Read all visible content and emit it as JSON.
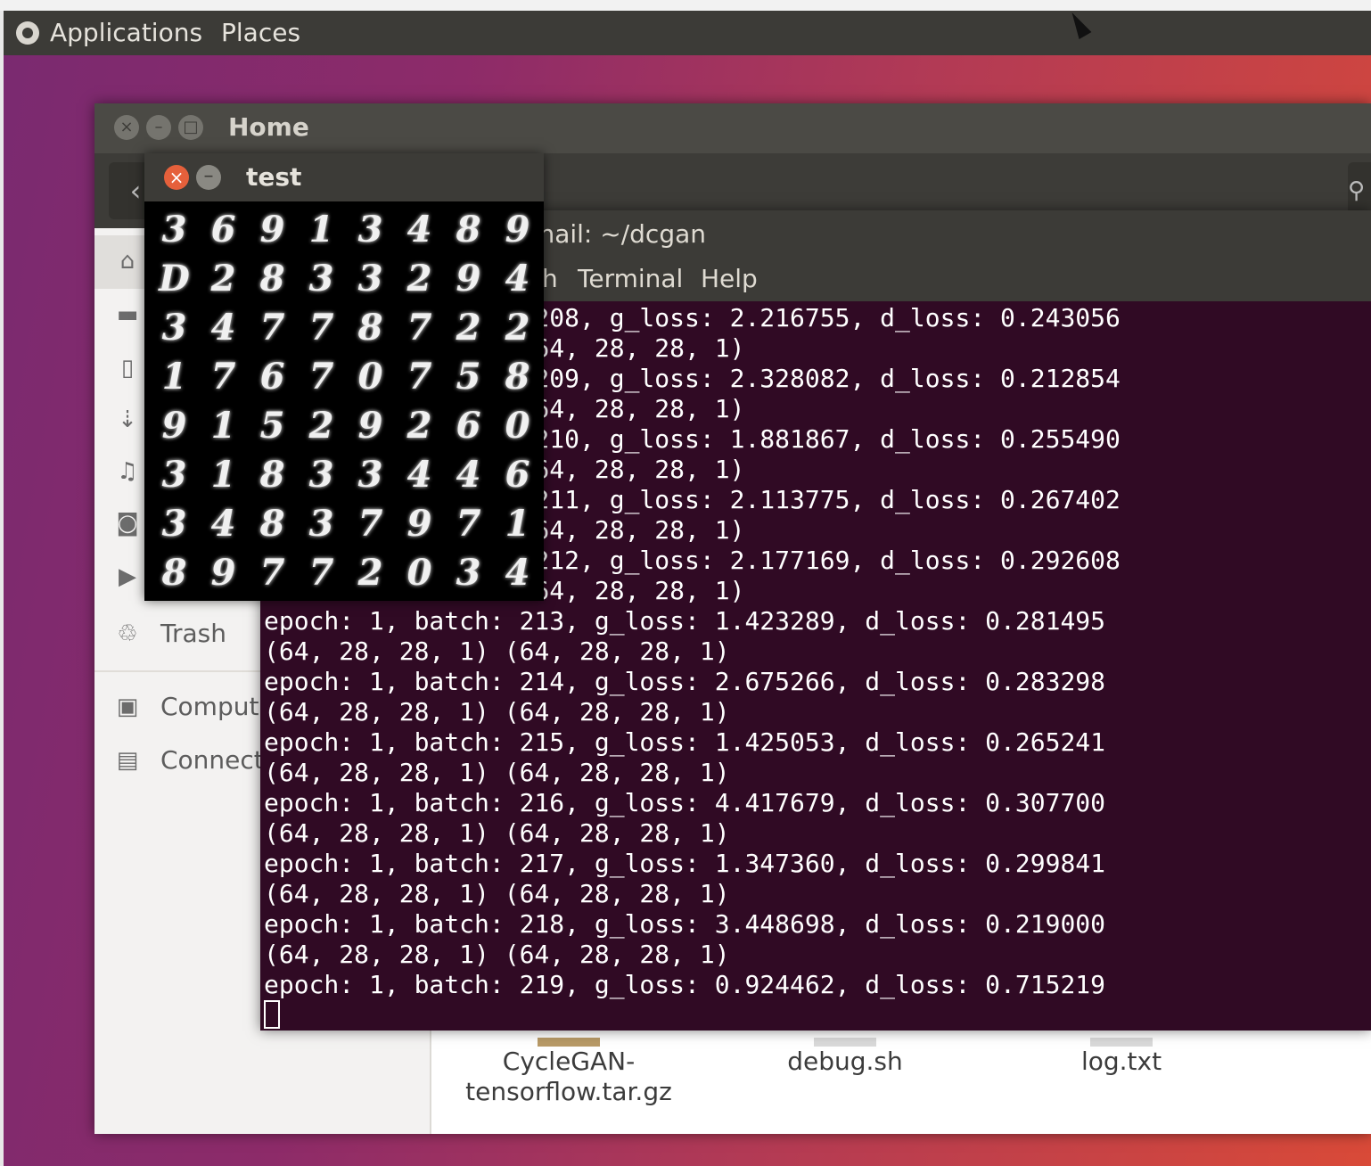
{
  "panel": {
    "menus": [
      "Applications",
      "Places"
    ]
  },
  "home_window": {
    "title": "Home",
    "sidebar": [
      {
        "icon": "home-icon",
        "label": ""
      },
      {
        "icon": "folder-icon",
        "label": ""
      },
      {
        "icon": "document-icon",
        "label": ""
      },
      {
        "icon": "download-icon",
        "label": ""
      },
      {
        "icon": "music-icon",
        "label": ""
      },
      {
        "icon": "camera-icon",
        "label": ""
      },
      {
        "icon": "video-icon",
        "label": ""
      },
      {
        "icon": "trash-icon",
        "label": "Trash"
      },
      {
        "icon": "computer-icon",
        "label": "Comput"
      },
      {
        "icon": "connect-icon",
        "label": "Connect"
      }
    ],
    "files": [
      {
        "name": "CycleGAN-\ntensorflow.tar.gz",
        "icon": "archive-icon"
      },
      {
        "name": "debug.sh",
        "icon": "script-icon"
      },
      {
        "name": "log.txt",
        "icon": "text-file-icon"
      }
    ]
  },
  "terminal": {
    "title": "nail: ~/dcgan",
    "menu": [
      "h",
      "Terminal",
      "Help"
    ],
    "lines": [
      "                  208, g_loss: 2.216755, d_loss: 0.243056",
      "                  64, 28, 28, 1)",
      "                  209, g_loss: 2.328082, d_loss: 0.212854",
      "                  64, 28, 28, 1)",
      "                  210, g_loss: 1.881867, d_loss: 0.255490",
      "                  64, 28, 28, 1)",
      "                  211, g_loss: 2.113775, d_loss: 0.267402",
      "                  64, 28, 28, 1)",
      "                  212, g_loss: 2.177169, d_loss: 0.292608",
      "                  64, 28, 28, 1)",
      "epoch: 1, batch: 213, g_loss: 1.423289, d_loss: 0.281495",
      "(64, 28, 28, 1) (64, 28, 28, 1)",
      "epoch: 1, batch: 214, g_loss: 2.675266, d_loss: 0.283298",
      "(64, 28, 28, 1) (64, 28, 28, 1)",
      "epoch: 1, batch: 215, g_loss: 1.425053, d_loss: 0.265241",
      "(64, 28, 28, 1) (64, 28, 28, 1)",
      "epoch: 1, batch: 216, g_loss: 4.417679, d_loss: 0.307700",
      "(64, 28, 28, 1) (64, 28, 28, 1)",
      "epoch: 1, batch: 217, g_loss: 1.347360, d_loss: 0.299841",
      "(64, 28, 28, 1) (64, 28, 28, 1)",
      "epoch: 1, batch: 218, g_loss: 3.448698, d_loss: 0.219000",
      "(64, 28, 28, 1) (64, 28, 28, 1)",
      "epoch: 1, batch: 219, g_loss: 0.924462, d_loss: 0.715219"
    ]
  },
  "test_window": {
    "title": "test",
    "digits": [
      "3",
      "6",
      "9",
      "1",
      "3",
      "4",
      "8",
      "9",
      "D",
      "2",
      "8",
      "3",
      "3",
      "2",
      "9",
      "4",
      "3",
      "4",
      "7",
      "7",
      "8",
      "7",
      "2",
      "2",
      "1",
      "7",
      "6",
      "7",
      "0",
      "7",
      "5",
      "8",
      "9",
      "1",
      "5",
      "2",
      "9",
      "2",
      "6",
      "0",
      "3",
      "1",
      "8",
      "3",
      "3",
      "4",
      "4",
      "6",
      "3",
      "4",
      "8",
      "3",
      "7",
      "9",
      "7",
      "1",
      "8",
      "9",
      "7",
      "7",
      "2",
      "0",
      "3",
      "4"
    ]
  }
}
